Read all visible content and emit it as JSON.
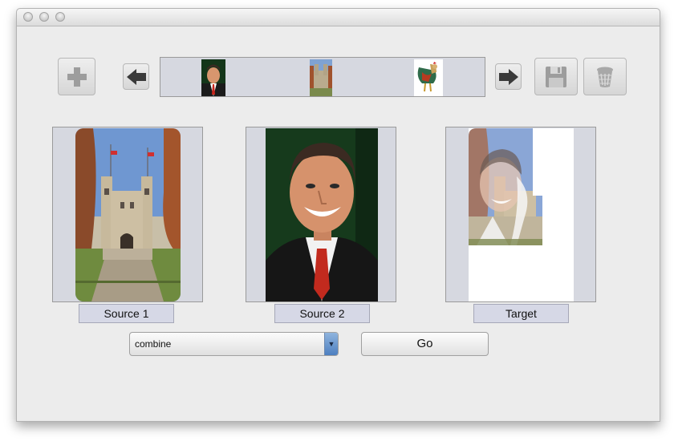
{
  "window": {
    "titlebar_buttons": [
      "close",
      "minimize",
      "zoom"
    ]
  },
  "toolbar": {
    "add_icon": "plus-icon",
    "prev_icon": "arrow-left-icon",
    "next_icon": "arrow-right-icon",
    "save_icon": "floppy-disk-icon",
    "delete_icon": "trash-can-icon"
  },
  "thumbnails": [
    {
      "image": "portrait of smiling man in suit"
    },
    {
      "image": "campus building with tower"
    },
    {
      "image": "rooster"
    }
  ],
  "panels": {
    "source1": {
      "label": "Source 1",
      "image": "campus building with trees"
    },
    "source2": {
      "label": "Source 2",
      "image": "portrait of smiling man in suit"
    },
    "target": {
      "label": "Target",
      "image": "combined blend of portrait and building"
    }
  },
  "controls": {
    "operation_value": "combine",
    "go_label": "Go"
  }
}
